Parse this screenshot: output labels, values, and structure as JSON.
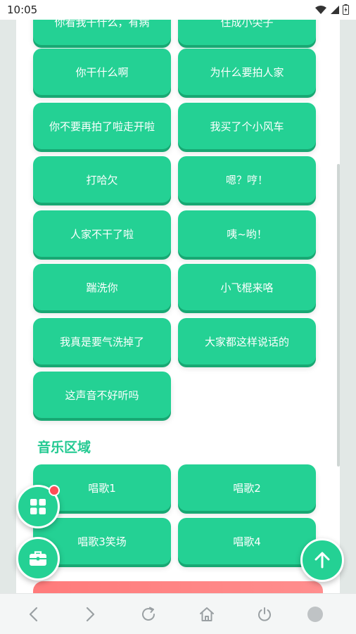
{
  "status_bar": {
    "time": "10:05"
  },
  "buttons": [
    {
      "label": "你看我干什么，有病"
    },
    {
      "label": "住成小尖子"
    },
    {
      "label": "你干什么啊"
    },
    {
      "label": "为什么要拍人家"
    },
    {
      "label": "你不要再拍了啦走开啦"
    },
    {
      "label": "我买了个小风车"
    },
    {
      "label": "打哈欠"
    },
    {
      "label": "嗯？哼！"
    },
    {
      "label": "人家不干了啦"
    },
    {
      "label": "咦~哟！"
    },
    {
      "label": "踹洗你"
    },
    {
      "label": "小飞棍来咯"
    },
    {
      "label": "我真是要气洗掉了"
    },
    {
      "label": "大家都这样说话的"
    },
    {
      "label": "这声音不好听吗"
    }
  ],
  "music_section": {
    "title": "音乐区域",
    "buttons": [
      {
        "label": "唱歌1"
      },
      {
        "label": "唱歌2"
      },
      {
        "label": "唱歌3笑场"
      },
      {
        "label": "唱歌4"
      }
    ]
  },
  "colors": {
    "button_green": "#24d194",
    "button_shadow": "#18a873",
    "section_title": "#22c991",
    "badge_red": "#ff4d57",
    "banner_red": "#ff7b7b"
  },
  "icons": {
    "wifi": "wifi-icon",
    "signal": "signal-icon",
    "battery": "battery-icon",
    "grid": "grid-icon",
    "toolbox": "toolbox-icon",
    "scroll_top": "arrow-up-icon",
    "nav_back": "chevron-left-icon",
    "nav_forward": "chevron-right-icon",
    "nav_refresh": "refresh-icon",
    "nav_home": "home-icon",
    "nav_power": "power-icon",
    "nav_circle": "circle-icon"
  }
}
